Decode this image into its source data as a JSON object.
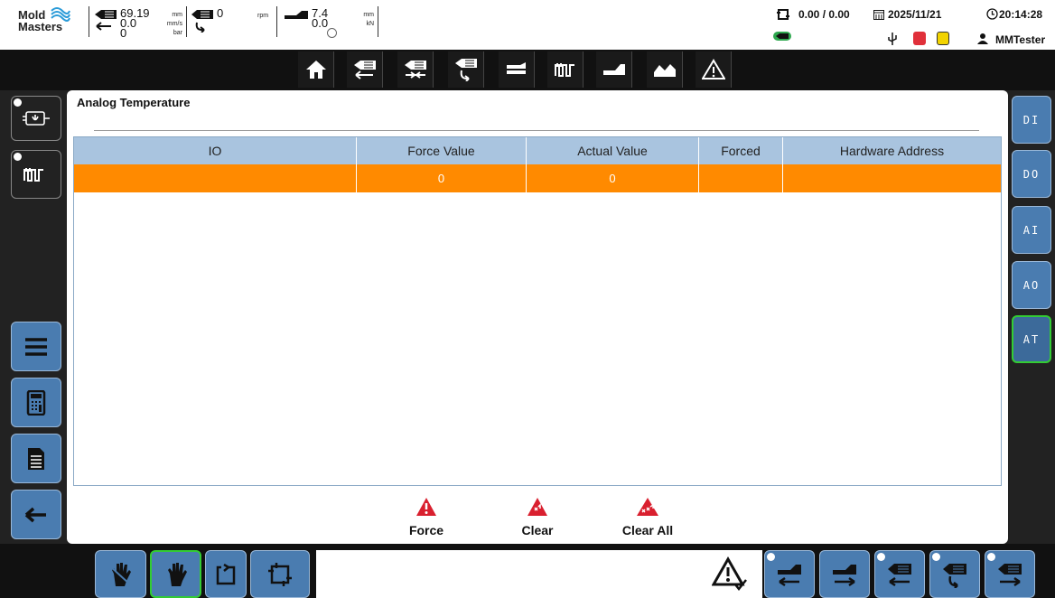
{
  "status": {
    "logo_line1": "Mold",
    "logo_line2": "Masters",
    "inj_pos": "69.19",
    "inj_speed": "0.0",
    "inj_pressure": "0",
    "unit_mm": "mm",
    "unit_mms": "mm/s",
    "unit_bar": "bar",
    "screw_speed": "0",
    "unit_rpm": "rpm",
    "clamp_pos": "7.4",
    "clamp_force": "0.0",
    "unit_mm2": "mm",
    "unit_kn": "kN",
    "cycle_time": "0.00 / 0.00",
    "date": "2025/11/21",
    "time": "20:14:28",
    "user": "MMTester",
    "icons": [
      "cycle-icon",
      "calendar-icon",
      "clock-icon",
      "usb-icon",
      "red-record-icon",
      "yellow-record-icon",
      "user-icon"
    ],
    "accent_red": "#e0303a",
    "accent_yellow": "#f2d300"
  },
  "toolbar": {
    "icons": [
      "home-icon",
      "injection-icon",
      "injection-hold-icon",
      "recovery-icon",
      "ejector-icon",
      "heater-icon",
      "clamp-icon",
      "graph-icon",
      "alarm-icon"
    ]
  },
  "left_sidebar": {
    "top_buttons": [
      "power-output-icon",
      "heater-zone-icon"
    ],
    "bottom_buttons": [
      "menu-icon",
      "calculator-icon",
      "document-icon",
      "back-arrow-icon"
    ]
  },
  "right_tabs": {
    "items": [
      {
        "label": "DI",
        "active": false
      },
      {
        "label": "DO",
        "active": false
      },
      {
        "label": "AI",
        "active": false
      },
      {
        "label": "AO",
        "active": false
      },
      {
        "label": "AT",
        "active": true
      }
    ]
  },
  "panel": {
    "title": "Analog Temperature",
    "columns": [
      "IO",
      "Force Value",
      "Actual Value",
      "Forced",
      "Hardware Address"
    ],
    "rows": [
      {
        "io": "",
        "force_value": "0",
        "actual_value": "0",
        "forced": "",
        "hardware_address": ""
      }
    ],
    "row_highlight_color": "#ff8a00",
    "header_color": "#a9c4df"
  },
  "actions": {
    "force_label": "Force",
    "clear_label": "Clear",
    "clear_all_label": "Clear All",
    "icon_color": "#d9202f"
  },
  "bottom": {
    "left_buttons": [
      "manual-hand-icon",
      "hand-icon",
      "semi-auto-icon",
      "auto-cycle-icon"
    ],
    "right_buttons": [
      "clamp-open-icon",
      "clamp-close-icon",
      "injection-back-icon",
      "recovery-screw-icon",
      "injection-forward-icon"
    ],
    "alarm_ack_icon": "alarm-acknowledge-icon"
  }
}
